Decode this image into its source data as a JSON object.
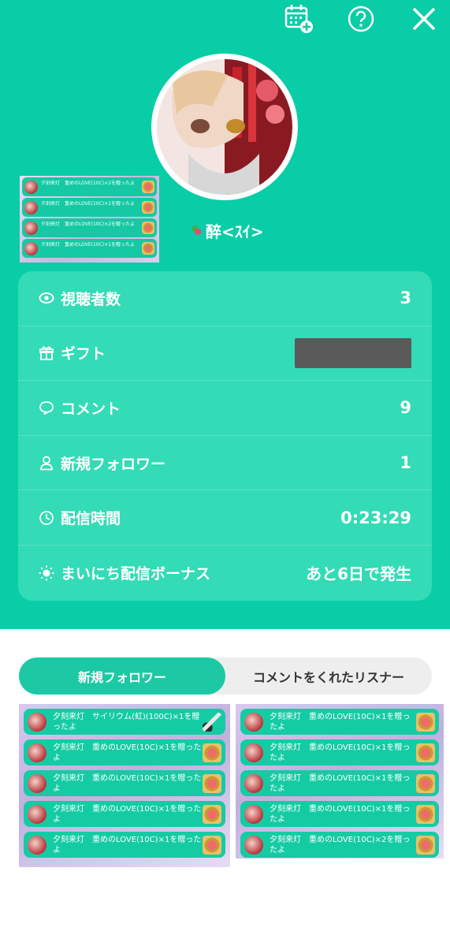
{
  "header": {
    "icons": [
      "calendar-add-icon",
      "help-icon",
      "close-icon"
    ]
  },
  "profile": {
    "username": "醉<ｽｲ>"
  },
  "gift_log_preview": [
    "夕刻来灯　重めのLOVE(10C)×2を贈ったよ",
    "夕刻来灯　重めのLOVE(10C)×1を贈ったよ",
    "夕刻来灯　重めのLOVE(10C)×2を贈ったよ",
    "夕刻来灯　重めのLOVE(10C)×1を贈ったよ"
  ],
  "stats": [
    {
      "icon": "eye-icon",
      "label": "視聴者数",
      "value": "3"
    },
    {
      "icon": "gift-icon",
      "label": "ギフト",
      "value": ""
    },
    {
      "icon": "comment-icon",
      "label": "コメント",
      "value": "9"
    },
    {
      "icon": "person-icon",
      "label": "新規フォロワー",
      "value": "1"
    },
    {
      "icon": "clock-icon",
      "label": "配信時間",
      "value": "0:23:29"
    },
    {
      "icon": "sun-icon",
      "label": "まいにち配信ボーナス",
      "value": "あと6日で発生"
    }
  ],
  "tabs": [
    {
      "label": "新規フォロワー",
      "active": true
    },
    {
      "label": "コメントをくれたリスナー",
      "active": false
    }
  ],
  "gift_log_left": [
    "夕刻来灯　サイリウム(虹)(100C)×1を贈ったよ",
    "夕刻来灯　重めのLOVE(10C)×1を贈ったよ",
    "夕刻来灯　重めのLOVE(10C)×1を贈ったよ",
    "夕刻来灯　重めのLOVE(10C)×1を贈ったよ",
    "夕刻来灯　重めのLOVE(10C)×1を贈ったよ"
  ],
  "gift_log_right": [
    "夕刻来灯　重めのLOVE(10C)×1を贈ったよ",
    "夕刻来灯　重めのLOVE(10C)×1を贈ったよ",
    "夕刻来灯　重めのLOVE(10C)×1を贈ったよ",
    "夕刻来灯　重めのLOVE(10C)×1を贈ったよ",
    "夕刻来灯　重めのLOVE(10C)×2を贈ったよ"
  ],
  "colors": {
    "accent": "#09cda7",
    "card": "#33dbb6",
    "tab_active": "#1cc9a4"
  }
}
